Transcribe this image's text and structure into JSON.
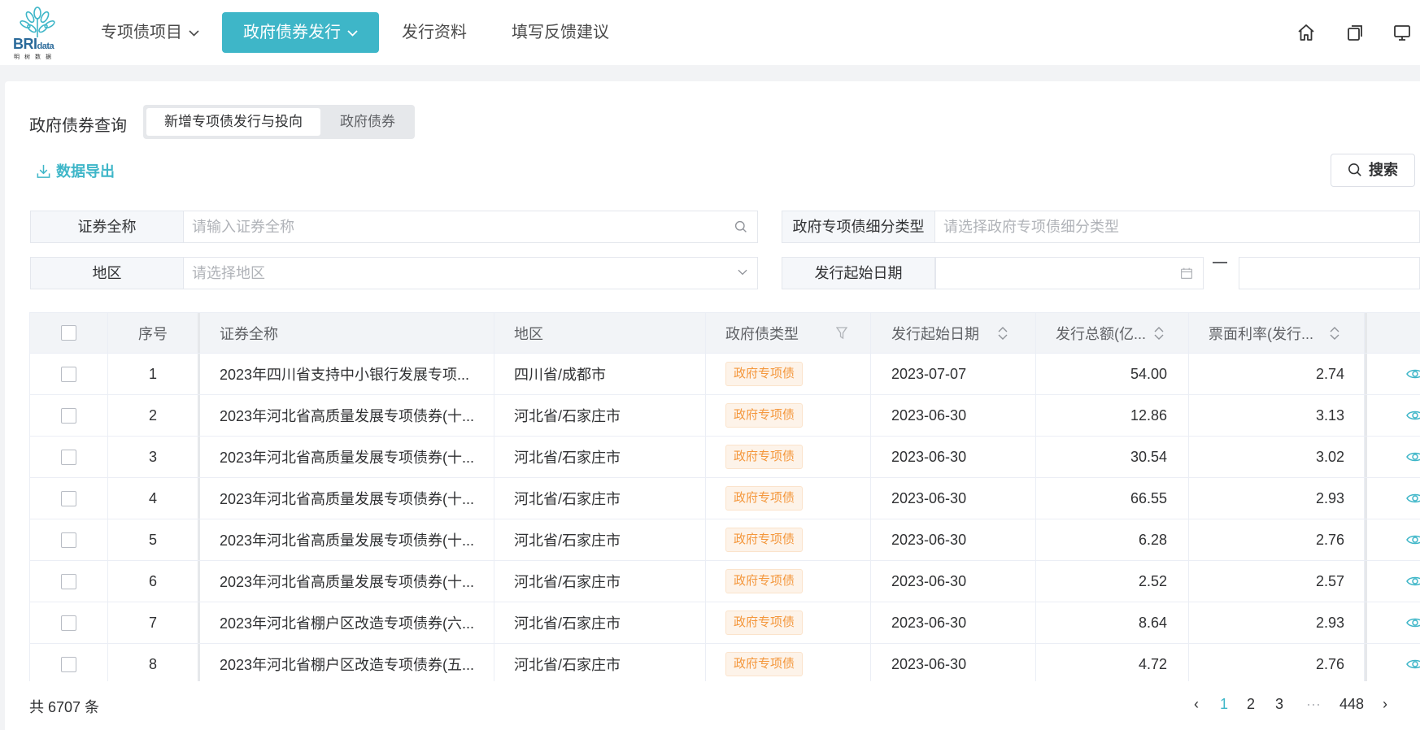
{
  "brand": {
    "logo_main": "BRI",
    "logo_suffix": "data",
    "logo_sub": "明树数据",
    "accent": "#3eb6c8"
  },
  "nav": {
    "items": [
      {
        "label": "专项债项目",
        "has_dropdown": true
      },
      {
        "label": "政府债券发行",
        "has_dropdown": true,
        "active": true
      },
      {
        "label": "发行资料"
      },
      {
        "label": "填写反馈建议"
      }
    ],
    "right_icons": [
      "home-icon",
      "copy-icon",
      "monitor-icon"
    ]
  },
  "query": {
    "title": "政府债券查询",
    "tabs": [
      {
        "label": "新增专项债发行与投向",
        "selected": true
      },
      {
        "label": "政府债券"
      }
    ],
    "export_label": "数据导出",
    "search_label": "搜索"
  },
  "filters": {
    "name": {
      "label": "证券全称",
      "placeholder": "请输入证券全称"
    },
    "subtype": {
      "label": "政府专项债细分类型",
      "placeholder": "请选择政府专项债细分类型"
    },
    "region": {
      "label": "地区",
      "placeholder": "请选择地区"
    },
    "date": {
      "label": "发行起始日期",
      "start": "",
      "end": ""
    }
  },
  "table": {
    "headers": {
      "index": "序号",
      "name": "证券全称",
      "region": "地区",
      "type": "政府债类型",
      "date": "发行起始日期",
      "amount": "发行总额(亿...",
      "rate": "票面利率(发行..."
    },
    "rows": [
      {
        "index": "1",
        "name": "2023年四川省支持中小银行发展专项...",
        "region": "四川省/成都市",
        "type": "政府专项债",
        "date": "2023-07-07",
        "amount": "54.00",
        "rate": "2.74"
      },
      {
        "index": "2",
        "name": "2023年河北省高质量发展专项债券(十...",
        "region": "河北省/石家庄市",
        "type": "政府专项债",
        "date": "2023-06-30",
        "amount": "12.86",
        "rate": "3.13"
      },
      {
        "index": "3",
        "name": "2023年河北省高质量发展专项债券(十...",
        "region": "河北省/石家庄市",
        "type": "政府专项债",
        "date": "2023-06-30",
        "amount": "30.54",
        "rate": "3.02"
      },
      {
        "index": "4",
        "name": "2023年河北省高质量发展专项债券(十...",
        "region": "河北省/石家庄市",
        "type": "政府专项债",
        "date": "2023-06-30",
        "amount": "66.55",
        "rate": "2.93"
      },
      {
        "index": "5",
        "name": "2023年河北省高质量发展专项债券(十...",
        "region": "河北省/石家庄市",
        "type": "政府专项债",
        "date": "2023-06-30",
        "amount": "6.28",
        "rate": "2.76"
      },
      {
        "index": "6",
        "name": "2023年河北省高质量发展专项债券(十...",
        "region": "河北省/石家庄市",
        "type": "政府专项债",
        "date": "2023-06-30",
        "amount": "2.52",
        "rate": "2.57"
      },
      {
        "index": "7",
        "name": "2023年河北省棚户区改造专项债券(六...",
        "region": "河北省/石家庄市",
        "type": "政府专项债",
        "date": "2023-06-30",
        "amount": "8.64",
        "rate": "2.93"
      },
      {
        "index": "8",
        "name": "2023年河北省棚户区改造专项债券(五...",
        "region": "河北省/石家庄市",
        "type": "政府专项债",
        "date": "2023-06-30",
        "amount": "4.72",
        "rate": "2.76"
      }
    ]
  },
  "footer": {
    "total": "共 6707 条",
    "pages": [
      "1",
      "2",
      "3",
      "···",
      "448"
    ],
    "current_page": "1",
    "prev": "‹",
    "next": "›"
  },
  "colors": {
    "accent": "#3eb6c8",
    "tag_text": "#f4973c",
    "tag_bg": "#fdf3e9"
  }
}
